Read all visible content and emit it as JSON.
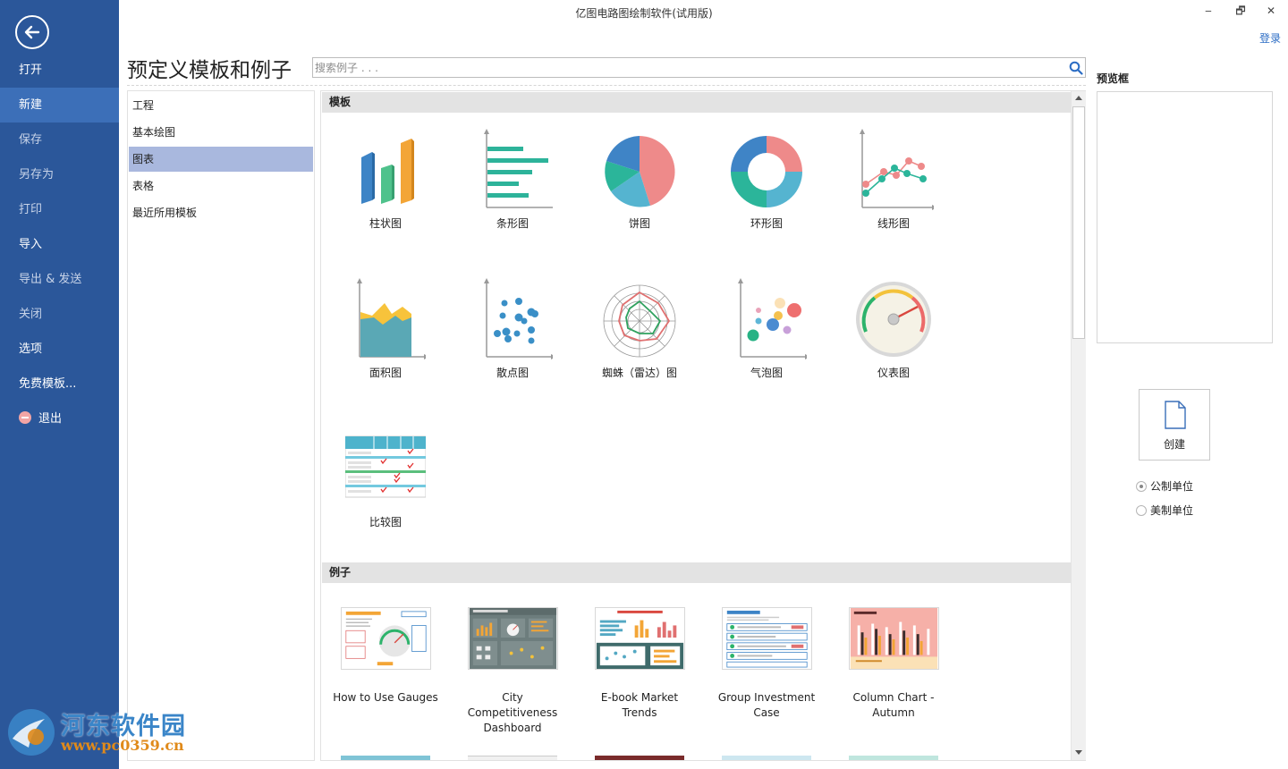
{
  "window": {
    "title": "亿图电路图绘制软件(试用版)",
    "minimize": "‒",
    "restore": "🗗",
    "close": "✕",
    "login": "登录"
  },
  "sidebar": {
    "items": [
      {
        "label": "打开"
      },
      {
        "label": "新建"
      },
      {
        "label": "保存"
      },
      {
        "label": "另存为"
      },
      {
        "label": "打印"
      },
      {
        "label": "导入"
      },
      {
        "label": "导出 & 发送"
      },
      {
        "label": "关闭"
      },
      {
        "label": "选项"
      },
      {
        "label": "免费模板..."
      },
      {
        "label": "退出"
      }
    ]
  },
  "main": {
    "title": "预定义模板和例子",
    "search_placeholder": "搜索例子 . . ."
  },
  "categories": [
    {
      "label": "工程"
    },
    {
      "label": "基本绘图"
    },
    {
      "label": "图表",
      "selected": true
    },
    {
      "label": "表格"
    },
    {
      "label": "最近所用模板"
    }
  ],
  "templates": {
    "heading": "模板",
    "items": [
      {
        "label": "柱状图",
        "icon": "bar-chart-icon"
      },
      {
        "label": "条形图",
        "icon": "horizontal-bar-chart-icon"
      },
      {
        "label": "饼图",
        "icon": "pie-chart-icon"
      },
      {
        "label": "环形图",
        "icon": "donut-chart-icon"
      },
      {
        "label": "线形图",
        "icon": "line-chart-icon"
      },
      {
        "label": "面积图",
        "icon": "area-chart-icon"
      },
      {
        "label": "散点图",
        "icon": "scatter-chart-icon"
      },
      {
        "label": "蜘蛛（雷达）图",
        "icon": "radar-chart-icon"
      },
      {
        "label": "气泡图",
        "icon": "bubble-chart-icon"
      },
      {
        "label": "仪表图",
        "icon": "gauge-chart-icon"
      },
      {
        "label": "比较图",
        "icon": "comparison-chart-icon"
      }
    ]
  },
  "examples": {
    "heading": "例子",
    "items": [
      {
        "label": "How to Use Gauges"
      },
      {
        "label": "City Competitiveness Dashboard"
      },
      {
        "label": "E-book Market Trends"
      },
      {
        "label": "Group Investment Case"
      },
      {
        "label": "Column Chart - Autumn"
      }
    ]
  },
  "preview": {
    "label": "预览框",
    "create_label": "创建",
    "units": [
      {
        "label": "公制单位",
        "checked": true
      },
      {
        "label": "美制单位",
        "checked": false
      }
    ]
  },
  "watermark": {
    "name": "河东软件园",
    "url": "www.pc0359.cn"
  },
  "colors": {
    "sidebar": "#2b579a",
    "sidebar_active": "#3c6fb8",
    "category_selected": "#a9b8de",
    "section_header": "#e3e3e3",
    "link": "#2b6cc4"
  }
}
